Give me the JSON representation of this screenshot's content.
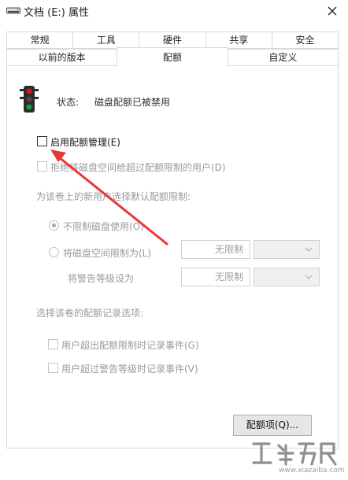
{
  "window": {
    "title": "文档 (E:) 属性",
    "close_label": "×"
  },
  "tabs": {
    "row1": [
      "常规",
      "工具",
      "硬件",
      "共享",
      "安全"
    ],
    "row2": [
      "以前的版本",
      "配额",
      "自定义"
    ],
    "active": "配额"
  },
  "status": {
    "label": "状态:",
    "value": "磁盘配额已被禁用"
  },
  "options": {
    "enable_quota": {
      "label": "启用配额管理(E)",
      "checked": false,
      "enabled": true
    },
    "deny_space": {
      "label": "拒绝将磁盘空间给超过配额限制的用户(D)",
      "checked": false,
      "enabled": false
    }
  },
  "default_limit": {
    "heading": "为该卷上的新用户选择默认配额限制:",
    "no_limit_label": "不限制磁盘使用(O)",
    "no_limit_selected": true,
    "limit_label": "将磁盘空间限制为(L)",
    "limit_value": "无限制",
    "warning_label": "将警告等级设为",
    "warning_value": "无限制"
  },
  "logging": {
    "heading": "选择该卷的配额记录选项:",
    "log_over_limit": "用户超出配额限制时记录事件(G)",
    "log_over_warning": "用户超过警告等级时记录事件(V)"
  },
  "buttons": {
    "quota_entries": "配额项(Q)..."
  },
  "watermark": {
    "text": "www.xiazaiba.com"
  },
  "colors": {
    "arrow": "#e53935",
    "light_red": "#d81b1b",
    "light_yellow": "#2e2e2e",
    "light_green": "#1a9c3a"
  }
}
